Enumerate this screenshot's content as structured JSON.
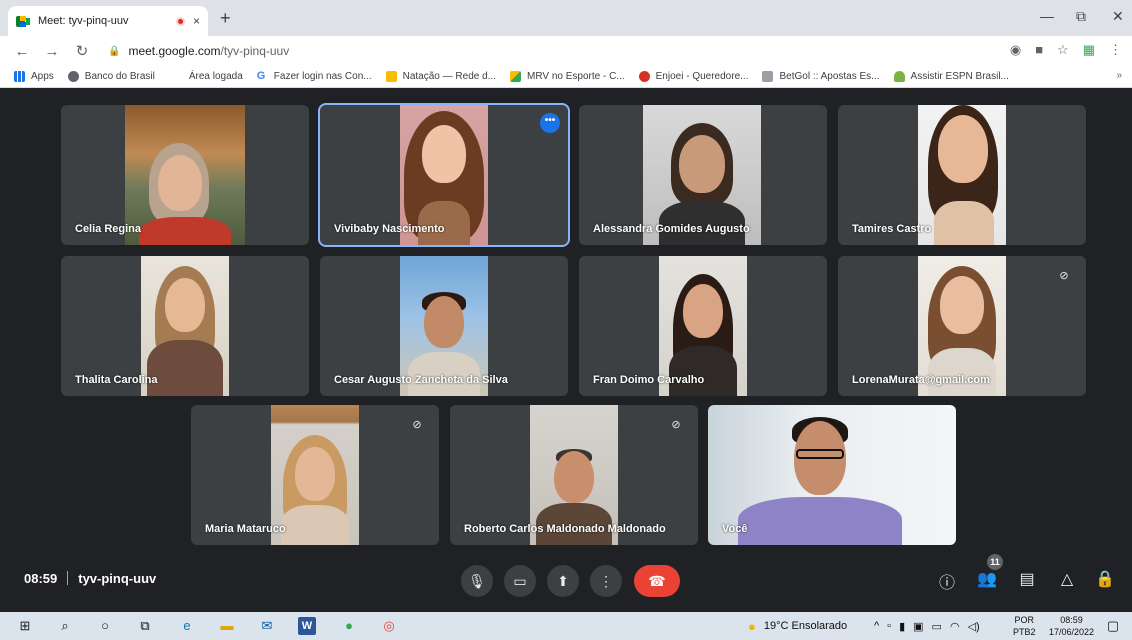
{
  "browser": {
    "tab_title": "Meet: tyv-pinq-uuv",
    "tab_close": "×",
    "new_tab": "+",
    "window_minimize": "—",
    "window_restore": "⧉",
    "window_close": "✕",
    "url_host": "meet.google.com",
    "url_path": "/tyv-pinq-uuv",
    "bookmarks": [
      {
        "label": "Apps",
        "icon": "apps-grid-icon",
        "color": "#1a73e8"
      },
      {
        "label": "Banco do Brasil",
        "icon": "globe-icon",
        "color": "#5f6368"
      },
      {
        "label": "Área logada",
        "icon": "",
        "color": ""
      },
      {
        "label": "Fazer login nas Con...",
        "icon": "google-icon",
        "color": "#4285f4"
      },
      {
        "label": "Natação — Rede d...",
        "icon": "heart-icon",
        "color": "#fbbc04"
      },
      {
        "label": "MRV no Esporte - C...",
        "icon": "mrv-icon",
        "color": "#34a853"
      },
      {
        "label": "Enjoei - Queredore...",
        "icon": "enjoei-icon",
        "color": "#d93025"
      },
      {
        "label": "BetGol :: Apostas Es...",
        "icon": "betgol-icon",
        "color": "#9aa0a6"
      },
      {
        "label": "Assistir ESPN Brasil...",
        "icon": "espn-icon",
        "color": "#7cb342"
      }
    ],
    "bookmarks_more": "»"
  },
  "participants": [
    {
      "name": "Celia Regina",
      "muted": false
    },
    {
      "name": "Vivibaby Nascimento",
      "muted": false,
      "active": true
    },
    {
      "name": "Alessandra Gomides Augusto",
      "muted": false
    },
    {
      "name": "Tamires Castro",
      "muted": false
    },
    {
      "name": "Thalita Carolina",
      "muted": false
    },
    {
      "name": "Cesar Augusto Zancheta da Silva",
      "muted": false
    },
    {
      "name": "Fran Doimo Carvalho",
      "muted": false
    },
    {
      "name": "LorenaMurata@gmail.com",
      "muted": true
    },
    {
      "name": "Maria Mataruco",
      "muted": true
    },
    {
      "name": "Roberto Carlos Maldonado Maldonado",
      "muted": true
    },
    {
      "name": "Você",
      "muted": false
    }
  ],
  "more_options": "•••",
  "meeting": {
    "time": "08:59",
    "code": "tyv-pinq-uuv",
    "participant_count": "11"
  },
  "taskbar": {
    "weather": "19°C  Ensolarado",
    "lang_top": "POR",
    "lang_bottom": "PTB2",
    "time": "08:59",
    "date": "17/06/2022"
  }
}
